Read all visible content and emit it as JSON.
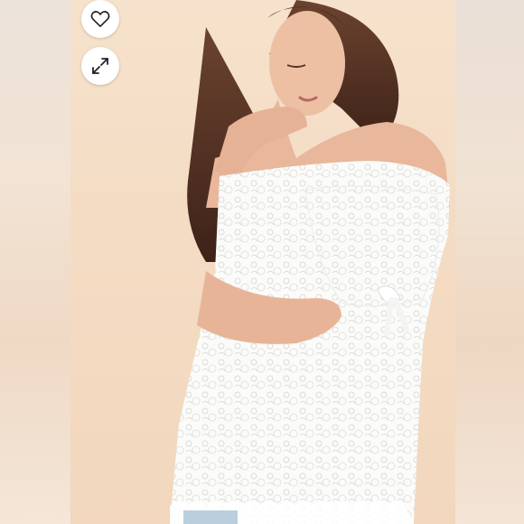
{
  "viewer": {
    "image_subject": "",
    "actions": [
      {
        "icon": "heart-icon",
        "role": "like"
      },
      {
        "icon": "expand-icon",
        "role": "fullscreen"
      }
    ]
  },
  "colors": {
    "background": "#f3ece6",
    "photo_backdrop": "#f4dcc4",
    "skin": "#e9b79b",
    "hair": "#5a3424",
    "lace_top": "#fbfbfa",
    "button_bg": "#ffffff",
    "icon_stroke": "#222222"
  }
}
